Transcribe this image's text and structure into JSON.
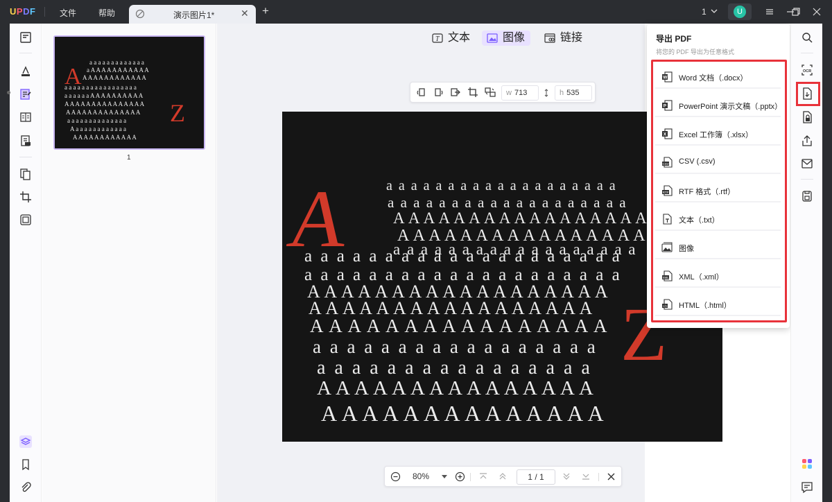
{
  "app": {
    "logo": "UPDF",
    "menus": [
      "文件",
      "帮助"
    ],
    "tab_title": "演示图片1*",
    "page_indicator": "1",
    "avatar_letter": "U"
  },
  "colors": {
    "accent": "#7a5cff",
    "highlight_red": "#e8323a",
    "active_mode_bg": "#e8e1ff"
  },
  "modes": {
    "text": "文本",
    "image": "图像",
    "link": "链接"
  },
  "image_tools": {
    "width_label": "w",
    "width_value": "713",
    "height_label": "h",
    "height_value": "535"
  },
  "thumbnail": {
    "page_number": "1"
  },
  "export_panel": {
    "title": "导出 PDF",
    "subtitle": "将您的 PDF 导出为任意格式",
    "items": [
      {
        "label": "Word 文档（.docx）",
        "icon": "word-icon"
      },
      {
        "label": "PowerPoint 演示文稿（.pptx）",
        "icon": "powerpoint-icon"
      },
      {
        "label": "Excel 工作簿（.xlsx）",
        "icon": "excel-icon"
      },
      {
        "label": "CSV (.csv)",
        "icon": "csv-icon"
      },
      {
        "label": "RTF 格式（.rtf）",
        "icon": "rtf-icon"
      },
      {
        "label": "文本（.txt）",
        "icon": "txt-icon"
      },
      {
        "label": "图像",
        "icon": "image-icon"
      },
      {
        "label": "XML（.xml）",
        "icon": "xml-icon"
      },
      {
        "label": "HTML（.html）",
        "icon": "html-icon"
      }
    ]
  },
  "zoom_bar": {
    "zoom": "80%",
    "current_page": "1",
    "separator": "/",
    "total_pages": "1"
  }
}
